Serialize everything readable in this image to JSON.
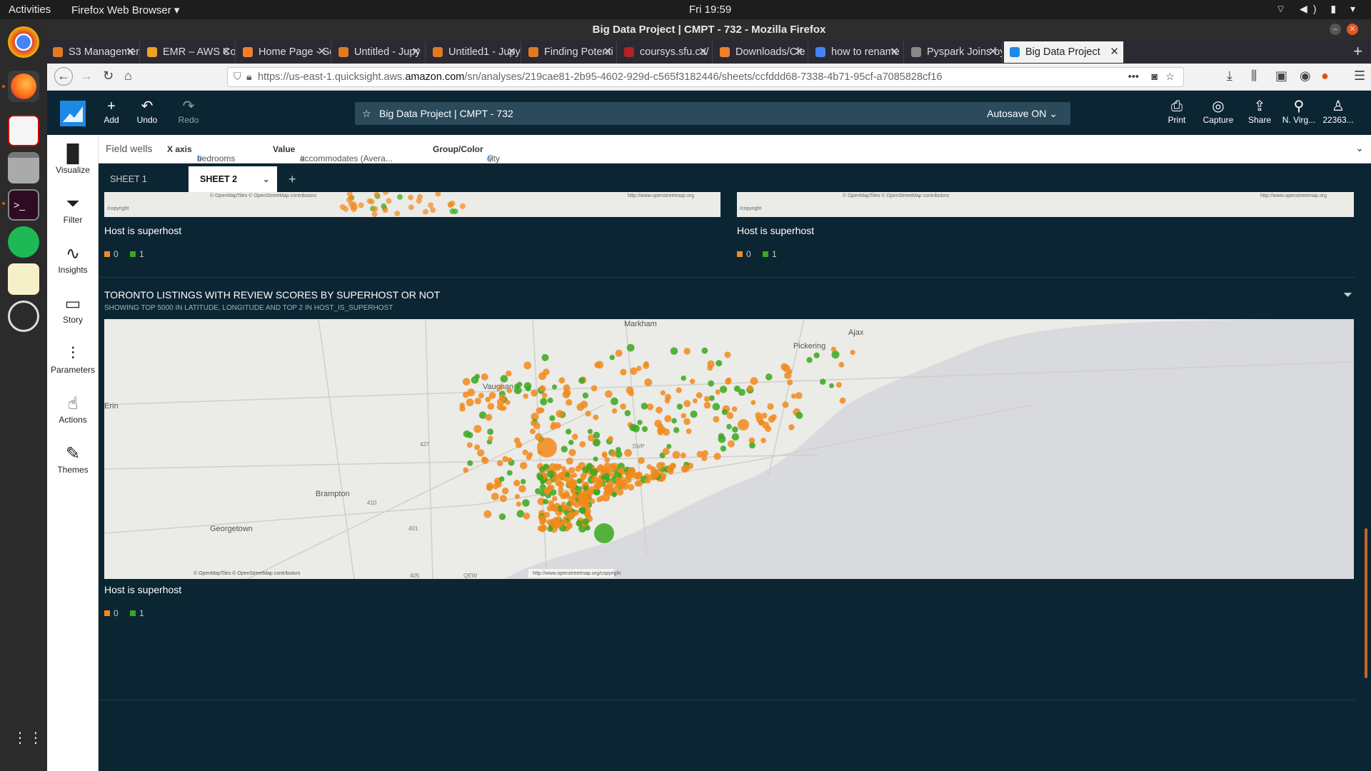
{
  "topbar": {
    "activities": "Activities",
    "app": "Firefox Web Browser ▾",
    "clock": "Fri 19:59"
  },
  "firefox": {
    "window_title": "Big Data Project | CMPT - 732 - Mozilla Firefox"
  },
  "tabs": [
    {
      "label": "S3 Management",
      "color": "#e07b20"
    },
    {
      "label": "EMR – AWS Con",
      "color": "#f0a020"
    },
    {
      "label": "Home Page - Se",
      "color": "#f08030"
    },
    {
      "label": "Untitled - Jupy",
      "color": "#e07b20"
    },
    {
      "label": "Untitled1 - Jupy",
      "color": "#e07b20"
    },
    {
      "label": "Finding Potenti",
      "color": "#e07b20"
    },
    {
      "label": "coursys.sfu.ca/",
      "color": "#b22222"
    },
    {
      "label": "Downloads/Cle",
      "color": "#f08030"
    },
    {
      "label": "how to rename",
      "color": "#4285f4"
    },
    {
      "label": "Pyspark Joins by E",
      "color": "#888888"
    },
    {
      "label": "Big Data Project",
      "color": "#1e88e5"
    }
  ],
  "url": {
    "prefix": "https://us-east-1.quicksight.aws.",
    "domain": "amazon.com",
    "path": "/sn/analyses/219cae81-2b95-4602-929d-c565f3182446/sheets/ccfddd68-7338-4b71-95cf-a7085828cf16"
  },
  "header": {
    "add": "Add",
    "undo": "Undo",
    "redo": "Redo",
    "analysis_name": "Big Data Project | CMPT - 732",
    "autosave": "Autosave ON",
    "print": "Print",
    "capture": "Capture",
    "share": "Share",
    "region": "N. Virg...",
    "user": "22363..."
  },
  "rail": {
    "visualize": "Visualize",
    "filter": "Filter",
    "insights": "Insights",
    "story": "Story",
    "parameters": "Parameters",
    "actions": "Actions",
    "themes": "Themes"
  },
  "wells": {
    "label": "Field wells",
    "xaxis_label": "X axis",
    "xaxis_value": "bedrooms",
    "value_label": "Value",
    "value_value": "accommodates (Avera...",
    "group_label": "Group/Color",
    "group_value": "city"
  },
  "sheets": {
    "sheet1": "SHEET 1",
    "sheet2": "SHEET 2"
  },
  "visual_top_left": {
    "legend_title": "Host is superhost",
    "legend": [
      "0",
      "1"
    ],
    "copyright": "© OpenMapTiles © OpenStreetMap contributors",
    "osm_url": "http://www.openstreetmap.org",
    "copyright_short": "/copyright"
  },
  "visual_top_right": {
    "legend_title": "Host is superhost",
    "legend": [
      "0",
      "1"
    ],
    "copyright": "© OpenMapTiles © OpenStreetMap contributors",
    "osm_url": "http://www.openstreetmap.org",
    "copyright_short": "/copyright"
  },
  "main_visual": {
    "title": "TORONTO LISTINGS WITH REVIEW SCORES BY SUPERHOST OR NOT",
    "subtitle": "SHOWING TOP 5000 IN LATITUDE, LONGITUDE AND TOP 2 IN HOST_IS_SUPERHOST",
    "legend_title": "Host is superhost",
    "legend": [
      "0",
      "1"
    ],
    "places": [
      "Markham",
      "Ajax",
      "Pickering",
      "Vaughan",
      "Erin",
      "Brampton",
      "Georgetown"
    ],
    "roads": [
      "427",
      "410",
      "401",
      "DVP",
      "405",
      "QEW"
    ],
    "copyright": "© OpenMapTiles © OpenStreetMap contributors",
    "osm_url": "http://www.openstreetmap.org/copyright"
  },
  "colors": {
    "host_0": "#f28a1b",
    "host_1": "#3aa81d",
    "accent": "#0c2533"
  }
}
